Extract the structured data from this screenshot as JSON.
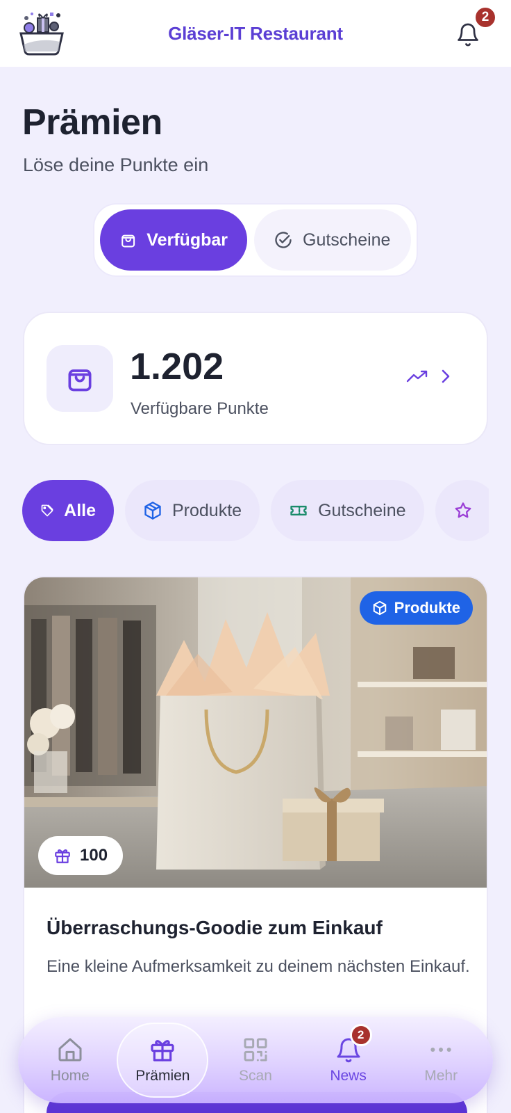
{
  "header": {
    "title": "Gläser-IT Restaurant",
    "notification_count": "2"
  },
  "page": {
    "title": "Prämien",
    "subtitle": "Löse deine Punkte ein"
  },
  "segmented": {
    "tabs": [
      {
        "label": "Verfügbar",
        "active": true,
        "icon": "shopping-bag-icon"
      },
      {
        "label": "Gutscheine",
        "active": false,
        "icon": "check-circle-icon"
      }
    ]
  },
  "points": {
    "value": "1.202",
    "label": "Verfügbare Punkte"
  },
  "filters": [
    {
      "label": "Alle",
      "icon": "tag-icon",
      "active": true
    },
    {
      "label": "Produkte",
      "icon": "box-icon",
      "active": false
    },
    {
      "label": "Gutscheine",
      "icon": "ticket-icon",
      "active": false
    },
    {
      "label": "",
      "icon": "star-icon",
      "active": false
    }
  ],
  "reward": {
    "category": "Produkte",
    "cost": "100",
    "title": "Überraschungs-Goodie zum Einkauf",
    "description": "Eine kleine Aufmerksamkeit zu deinem nächsten Einkauf."
  },
  "nav": {
    "items": [
      {
        "label": "Home",
        "icon": "home-icon"
      },
      {
        "label": "Prämien",
        "icon": "gift-icon",
        "active": true
      },
      {
        "label": "Scan",
        "icon": "qr-code-icon"
      },
      {
        "label": "News",
        "icon": "bell-icon",
        "badge": "2"
      },
      {
        "label": "Mehr",
        "icon": "more-dots-icon"
      }
    ]
  },
  "colors": {
    "accent": "#6a3fe0",
    "background": "#f1effd",
    "badge": "#a8322d",
    "category_badge": "#1f63e6"
  }
}
